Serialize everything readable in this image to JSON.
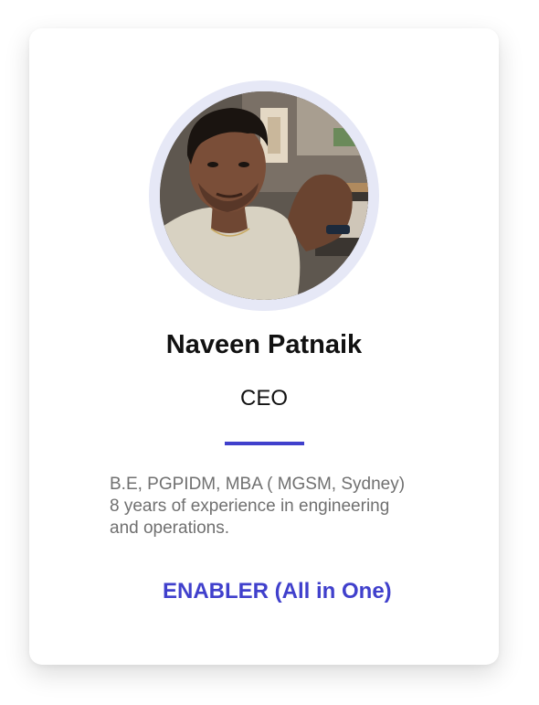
{
  "profile": {
    "name": "Naveen Patnaik",
    "role": "CEO",
    "bio_lines": [
      "B.E, PGPIDM, MBA ( MGSM, Sydney)",
      "8 years of experience in engineering",
      "and operations."
    ],
    "tagline": "ENABLER (All in One)"
  },
  "colors": {
    "accent": "#4040cc",
    "ring": "#e6e8f6",
    "bio_text": "#707070"
  }
}
